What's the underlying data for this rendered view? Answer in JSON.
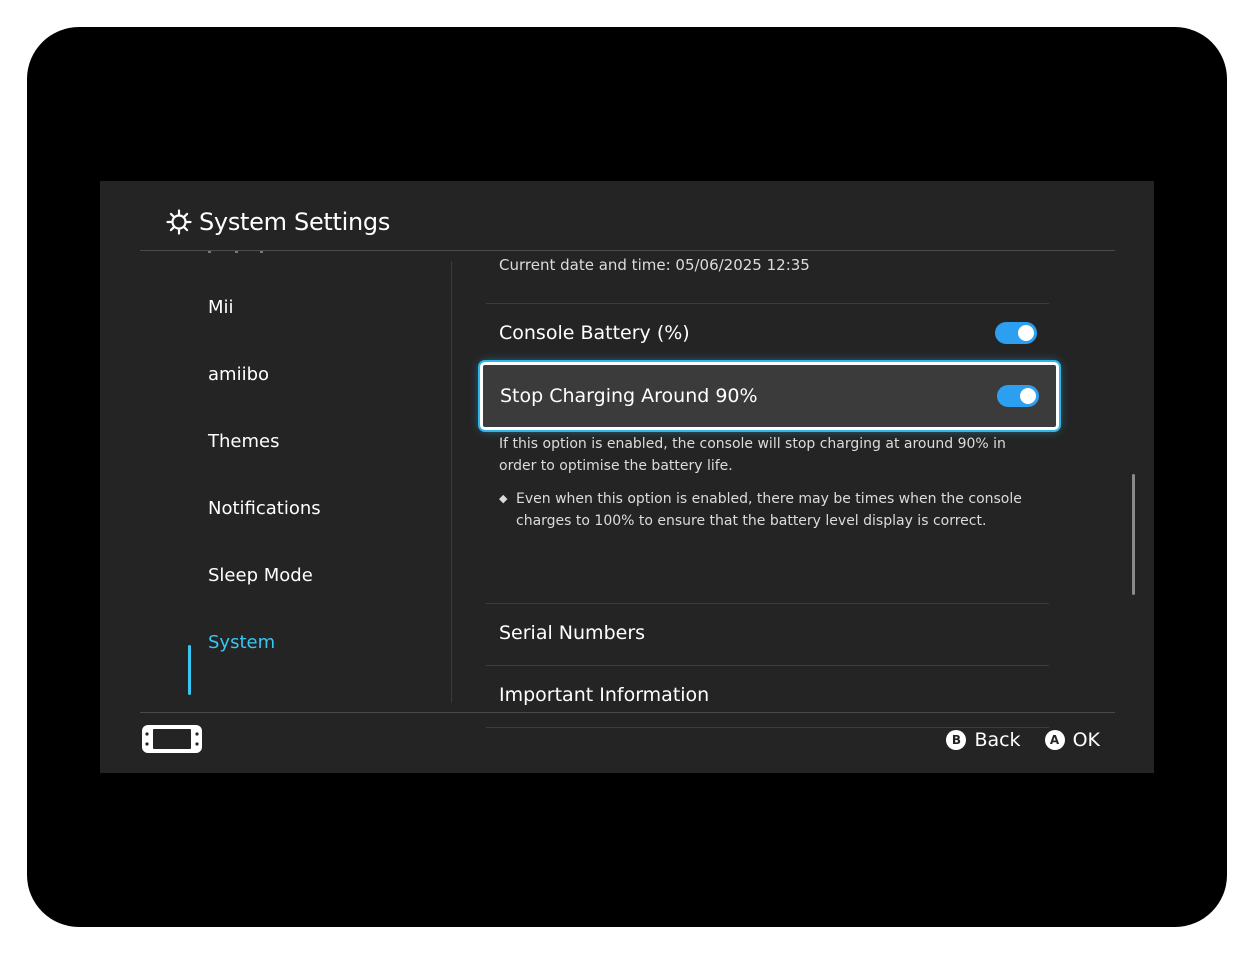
{
  "header": {
    "title": "System Settings",
    "icon": "gear-icon"
  },
  "sidebar": {
    "items": [
      {
        "label": "Mii",
        "active": false
      },
      {
        "label": "amiibo",
        "active": false
      },
      {
        "label": "Themes",
        "active": false
      },
      {
        "label": "Notifications",
        "active": false
      },
      {
        "label": "Sleep Mode",
        "active": false
      },
      {
        "label": "System",
        "active": true
      }
    ]
  },
  "main": {
    "datetime": "Current date and time: 05/06/2025 12:35",
    "console_battery": {
      "label": "Console Battery (%)",
      "enabled": true
    },
    "stop_charging": {
      "label": "Stop Charging Around 90%",
      "enabled": true
    },
    "description": "If this option is enabled, the console will stop charging at around 90% in order to optimise the battery life.",
    "note": "Even when this option is enabled, there may be times when the console charges to 100% to ensure that the battery level display is correct.",
    "note_bullet": "◆",
    "serial_numbers": "Serial Numbers",
    "important_information": "Important Information"
  },
  "footer": {
    "back": {
      "glyph": "B",
      "label": "Back"
    },
    "ok": {
      "glyph": "A",
      "label": "OK"
    }
  },
  "colors": {
    "accent": "#38c6f4",
    "toggle_on": "#2d9ff0",
    "background": "#242424"
  }
}
